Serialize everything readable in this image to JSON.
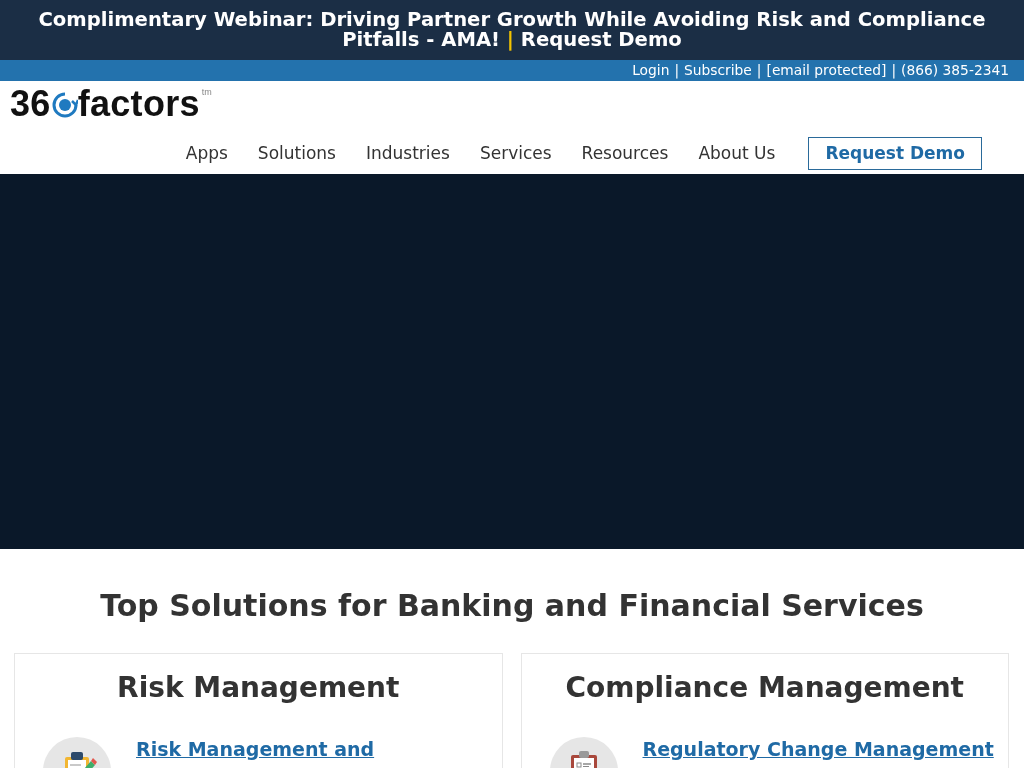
{
  "banner": {
    "message": "Complimentary Webinar: Driving Partner Growth While Avoiding Risk and Compliance Pitfalls - AMA!",
    "separator": "|",
    "link": "Request Demo"
  },
  "top_bar": {
    "items": [
      {
        "kind": "link",
        "text": "Login"
      },
      {
        "kind": "separator",
        "text": "|"
      },
      {
        "kind": "link",
        "text": "Subscribe"
      },
      {
        "kind": "separator",
        "text": "|"
      },
      {
        "kind": "link",
        "text": "[email protected]"
      },
      {
        "kind": "separator",
        "text": "|"
      },
      {
        "kind": "link",
        "text": "(866) 385-2341"
      }
    ]
  },
  "logo": {
    "prefix": "36",
    "name": "factors",
    "trademark": "tm"
  },
  "nav": {
    "items": [
      "Apps",
      "Solutions",
      "Industries",
      "Services",
      "Resources",
      "About Us"
    ],
    "button": "Request Demo"
  },
  "section": {
    "title": "Top Solutions for Banking and Financial Services",
    "cards": [
      {
        "title": "Risk Management",
        "links": [
          {
            "kind": "clipboard-pencil",
            "text": "Risk Management and"
          }
        ]
      },
      {
        "title": "Compliance Management",
        "links": [
          {
            "kind": "clipboard-checklist",
            "text": "Regulatory Change Management"
          }
        ]
      }
    ]
  }
}
